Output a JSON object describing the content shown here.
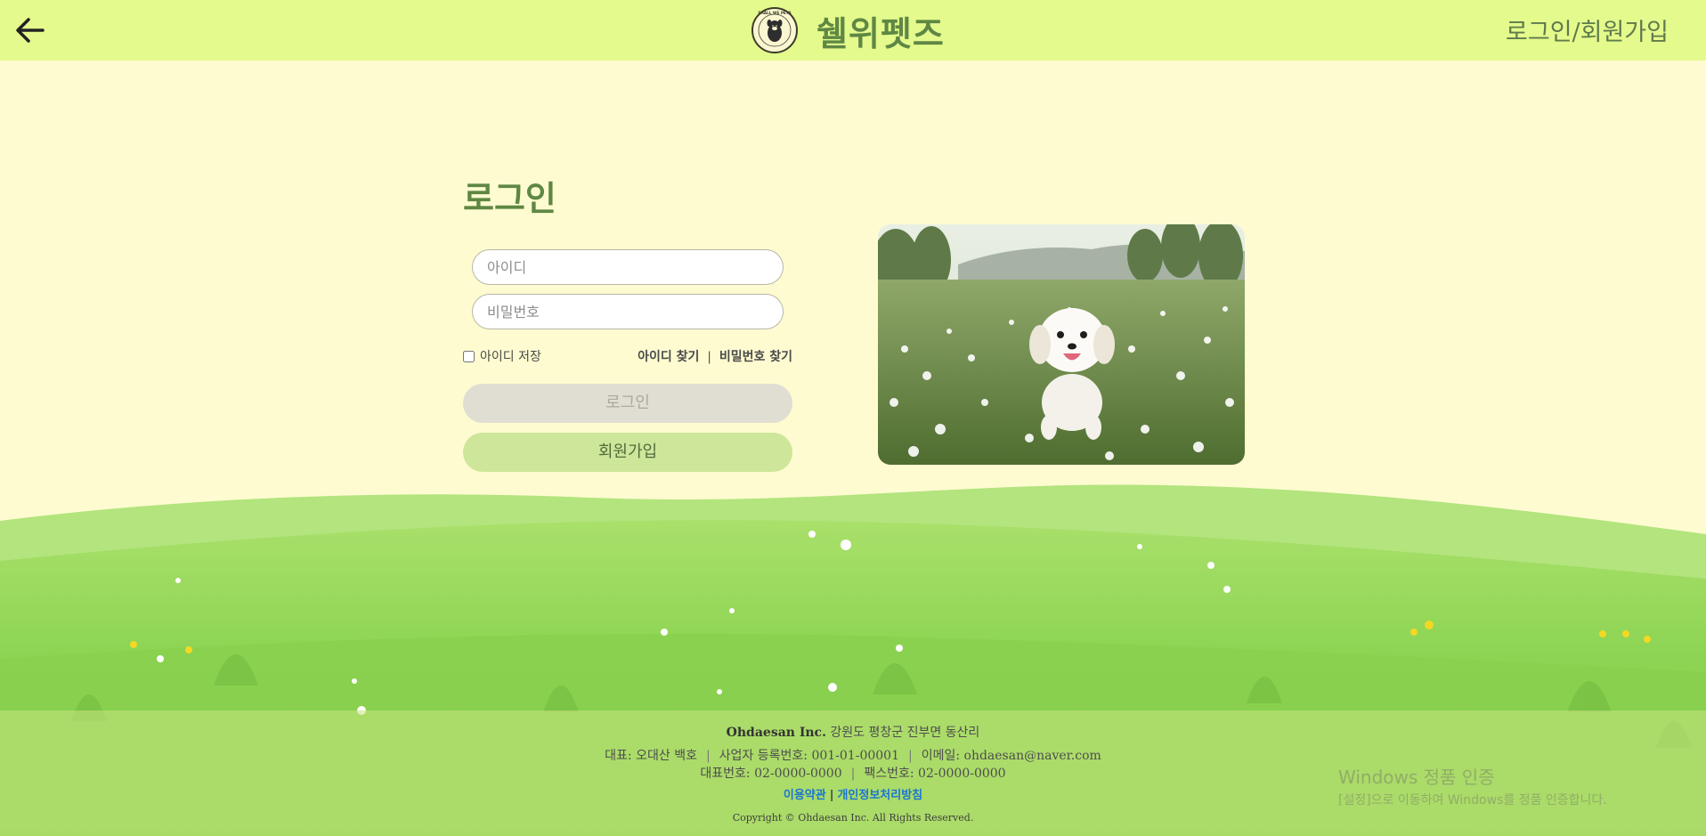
{
  "header": {
    "brand": "쉘위펫즈",
    "auth_link": "로그인/회원가입",
    "badge_text": "SHALL WE PETS"
  },
  "login": {
    "title": "로그인",
    "id_placeholder": "아이디",
    "pw_placeholder": "비밀번호",
    "save_id_label": "아이디 저장",
    "find_id": "아이디 찾기",
    "divider": "|",
    "find_pw": "비밀번호 찾기",
    "login_button": "로그인",
    "signup_button": "회원가입"
  },
  "footer": {
    "company": "Ohdaesan Inc.",
    "address": "강원도 평창군 진부면 동산리",
    "ceo": "대표: 오대산 백호",
    "biz_no": "사업자 등록번호: 001-01-00001",
    "email": "이메일: ohdaesan@naver.com",
    "phone": "대표번호: 02-0000-0000",
    "fax": "팩스번호: 02-0000-0000",
    "sep": "|",
    "terms": "이용약관",
    "privacy": "개인정보처리방침",
    "copyright": "Copyright © Ohdaesan Inc. All Rights Reserved."
  },
  "watermark": {
    "title": "Windows 정품 인증",
    "subtitle": "[설정]으로 이동하여 Windows를 정품 인증합니다."
  },
  "colors": {
    "header_bg": "#e4fa8c",
    "page_bg": "#fefbd0",
    "brand_green": "#5f8744",
    "login_btn_bg": "#e0ddd2",
    "signup_btn_bg": "#cde699",
    "link_blue": "#1976d2"
  }
}
